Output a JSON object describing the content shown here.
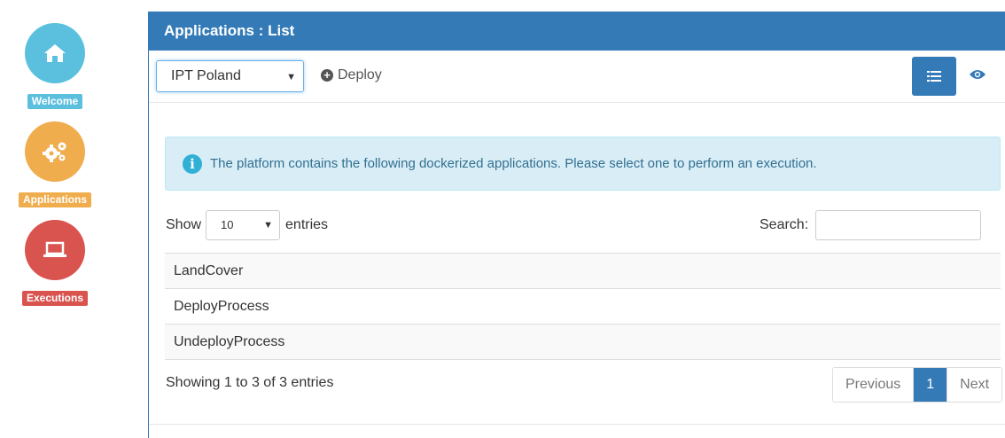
{
  "nav": {
    "items": [
      {
        "label": "Welcome",
        "icon": "home-icon",
        "color": "#5bc0de"
      },
      {
        "label": "Applications",
        "icon": "gears-icon",
        "color": "#f0ad4e"
      },
      {
        "label": "Executions",
        "icon": "laptop-icon",
        "color": "#d9534f"
      }
    ]
  },
  "panel": {
    "title": "Applications : List",
    "site_select": "IPT Poland",
    "deploy_label": "Deploy"
  },
  "alert": {
    "text": "The platform contains the following dockerized applications. Please select one to perform an execution."
  },
  "table": {
    "show_label": "Show",
    "page_size": "10",
    "entries_label": "entries",
    "search_label": "Search:",
    "search_value": "",
    "rows": [
      "LandCover",
      "DeployProcess",
      "UndeployProcess"
    ],
    "info": "Showing 1 to 3 of 3 entries"
  },
  "pagination": {
    "previous": "Previous",
    "current": "1",
    "next": "Next"
  },
  "colors": {
    "primary": "#337ab7",
    "info_bg": "#d9edf7",
    "info_text": "#31708f"
  }
}
